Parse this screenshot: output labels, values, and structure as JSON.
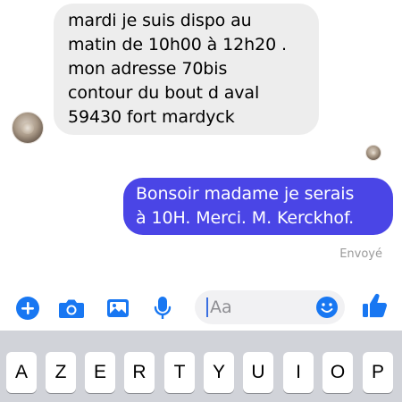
{
  "conversation": {
    "incoming": {
      "lines": [
        "mardi je suis dispo au",
        "matin de 10h00 à 12h20 .",
        "mon adresse 70bis",
        "contour du bout d aval",
        "59430 fort mardyck"
      ]
    },
    "outgoing": {
      "lines": [
        "Bonsoir madame je serais",
        "à 10H. Merci. M. Kerckhof."
      ],
      "status": "Envoyé"
    }
  },
  "composer": {
    "placeholder": "Aa",
    "icons": [
      "plus-icon",
      "camera-icon",
      "photo-icon",
      "microphone-icon",
      "emoji-icon",
      "thumbs-up-icon"
    ]
  },
  "keyboard": {
    "row1": [
      "A",
      "Z",
      "E",
      "R",
      "T",
      "Y",
      "U",
      "I",
      "O",
      "P"
    ]
  },
  "colors": {
    "accent": "#1877F2",
    "outgoing_bubble": "#4A45E6",
    "incoming_bubble": "#EDEDED",
    "keyboard_bg": "#D1D3D9"
  }
}
